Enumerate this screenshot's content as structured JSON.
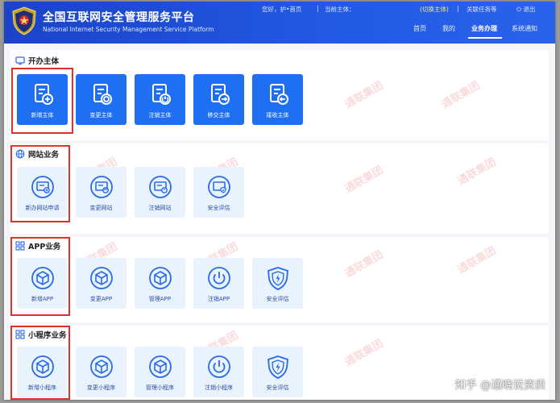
{
  "header": {
    "title_cn": "全国互联网安全管理服务平台",
    "title_en": "National Internet Security Management Service Platform",
    "topbar": {
      "greeting": "您好，护•首页",
      "sep1": "|",
      "current_subject": "当前主体：",
      "switch_subject": "(切换主体)",
      "sep2": "|",
      "close_tasks": "关联任务等",
      "exit": "退出"
    },
    "nav": [
      "首页",
      "我的",
      "业务办理",
      "系统通知"
    ],
    "active_nav": "业务办理"
  },
  "sections": [
    {
      "title": "开办主体",
      "style": "solid",
      "items": [
        {
          "label": "新增主体",
          "icon": "add-document-icon"
        },
        {
          "label": "变更主体",
          "icon": "change-document-icon"
        },
        {
          "label": "注销主体",
          "icon": "cancel-document-icon"
        },
        {
          "label": "移交主体",
          "icon": "transfer-document-icon"
        },
        {
          "label": "接收主体",
          "icon": "receive-document-icon"
        }
      ]
    },
    {
      "title": "网站业务",
      "style": "soft",
      "items": [
        {
          "label": "新办网站申请",
          "icon": "new-website-icon"
        },
        {
          "label": "变更网站",
          "icon": "change-website-icon"
        },
        {
          "label": "注销网站",
          "icon": "cancel-website-icon"
        },
        {
          "label": "安全评估",
          "icon": "security-assessment-icon"
        }
      ]
    },
    {
      "title": "APP业务",
      "style": "soft",
      "items": [
        {
          "label": "新增APP",
          "icon": "app-cube-icon"
        },
        {
          "label": "变更APP",
          "icon": "app-cube-icon"
        },
        {
          "label": "管理APP",
          "icon": "app-cube-icon"
        },
        {
          "label": "注销APP",
          "icon": "power-icon"
        },
        {
          "label": "安全评估",
          "icon": "shield-bolt-icon"
        }
      ]
    },
    {
      "title": "小程序业务",
      "style": "soft",
      "items": [
        {
          "label": "新增小程序",
          "icon": "app-cube-icon"
        },
        {
          "label": "变更小程序",
          "icon": "app-cube-icon"
        },
        {
          "label": "管理小程序",
          "icon": "app-cube-icon"
        },
        {
          "label": "注销小程序",
          "icon": "power-icon"
        },
        {
          "label": "安全评估",
          "icon": "shield-bolt-icon"
        }
      ]
    }
  ],
  "watermark_text": "通联集团",
  "credit": "知乎 @通晓说资质",
  "colors": {
    "header_blue": "#1e4bd6",
    "tile_blue": "#1f6ff2",
    "tile_soft": "#e9f3fe",
    "highlight_red": "#e0312d"
  }
}
